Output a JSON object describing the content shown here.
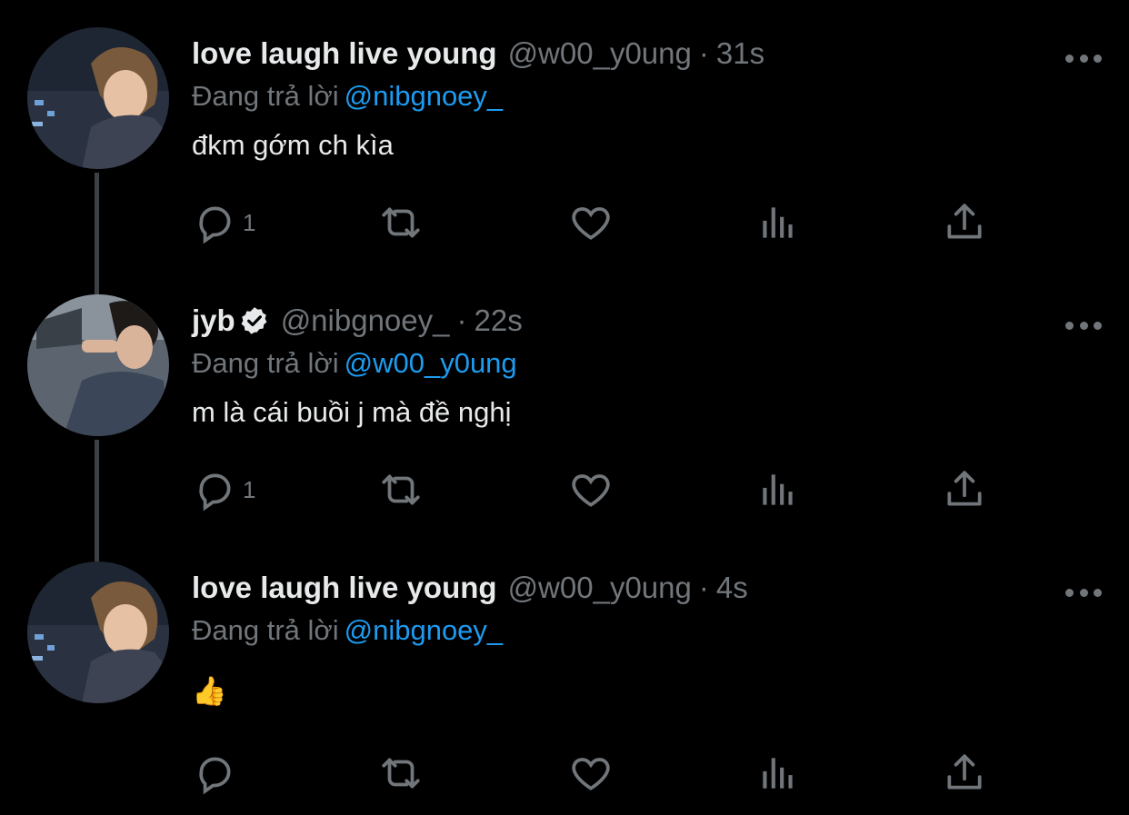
{
  "colors": {
    "background": "#000000",
    "text": "#e7e9ea",
    "muted": "#71767b",
    "accent": "#1d9bf0",
    "thread_line": "#3e4144"
  },
  "replying_label": "Đang trả lời",
  "tweets": [
    {
      "name": "love laugh live young",
      "handle": "@w00_y0ung",
      "separator": "·",
      "time": "31s",
      "verified": false,
      "replying_to": "@nibgnoey_",
      "text": "đkm gớm ch kìa",
      "reply_count": "1",
      "icons": [
        "reply-icon",
        "retweet-icon",
        "like-icon",
        "views-icon",
        "share-icon"
      ]
    },
    {
      "name": "jyb",
      "handle": "@nibgnoey_",
      "separator": "·",
      "time": "22s",
      "verified": true,
      "replying_to": "@w00_y0ung",
      "text": "m là cái buồi j mà đề nghị",
      "reply_count": "1",
      "icons": [
        "reply-icon",
        "retweet-icon",
        "like-icon",
        "views-icon",
        "share-icon"
      ]
    },
    {
      "name": "love laugh live young",
      "handle": "@w00_y0ung",
      "separator": "·",
      "time": "4s",
      "verified": false,
      "replying_to": "@nibgnoey_",
      "text": "👍",
      "reply_count": "",
      "icons": [
        "reply-icon",
        "retweet-icon",
        "like-icon",
        "views-icon",
        "share-icon"
      ]
    }
  ]
}
